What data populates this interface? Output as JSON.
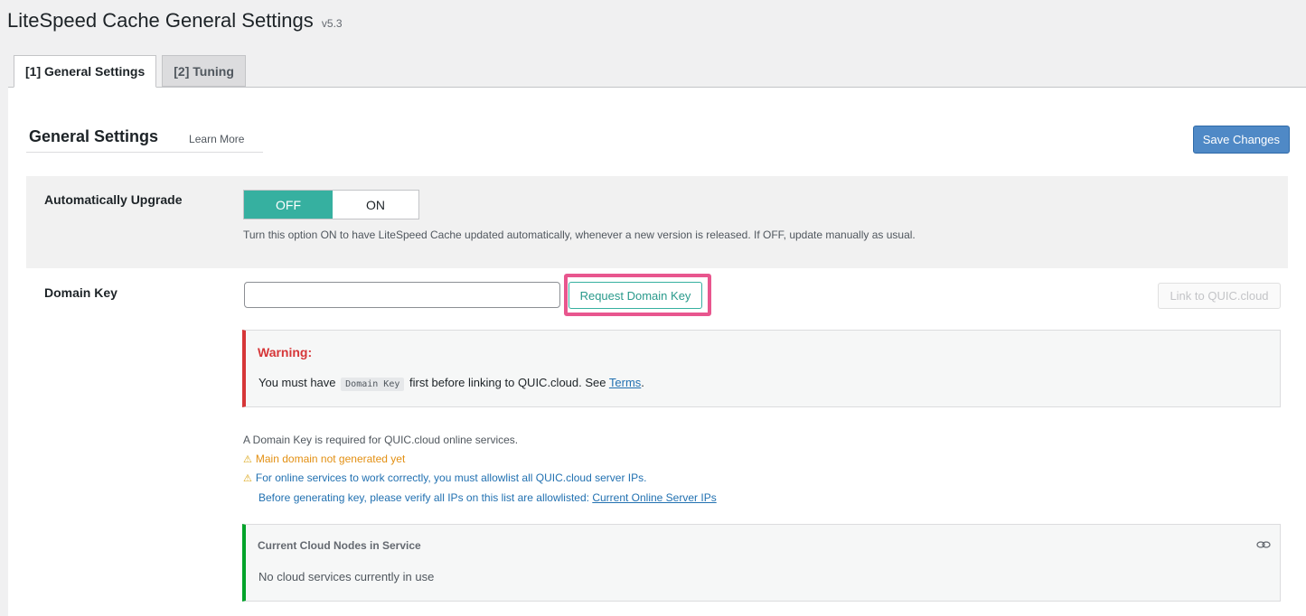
{
  "header": {
    "title": "LiteSpeed Cache General Settings",
    "version": "v5.3"
  },
  "tabs": [
    {
      "label": "[1] General Settings",
      "active": true
    },
    {
      "label": "[2] Tuning",
      "active": false
    }
  ],
  "section": {
    "title": "General Settings",
    "learn_more": "Learn More",
    "save_label": "Save Changes"
  },
  "auto_upgrade": {
    "label": "Automatically Upgrade",
    "off_label": "OFF",
    "on_label": "ON",
    "selected": "OFF",
    "description": "Turn this option ON to have LiteSpeed Cache updated automatically, whenever a new version is released. If OFF, update manually as usual."
  },
  "domain_key": {
    "label": "Domain Key",
    "input_value": "",
    "request_button": "Request Domain Key",
    "link_button": "Link to QUIC.cloud",
    "warning": {
      "title": "Warning:",
      "text_before": "You must have",
      "code": "Domain Key",
      "text_after": "first before linking to QUIC.cloud. See",
      "link": "Terms",
      "period": "."
    },
    "info": {
      "required": "A Domain Key is required for QUIC.cloud online services.",
      "main_domain": "Main domain not generated yet",
      "allowlist": "For online services to work correctly, you must allowlist all QUIC.cloud server IPs.",
      "verify_text": "Before generating key, please verify all IPs on this list are allowlisted:",
      "verify_link": "Current Online Server IPs"
    },
    "nodes": {
      "title": "Current Cloud Nodes in Service",
      "text": "No cloud services currently in use",
      "icon": "link-icon"
    }
  },
  "colors": {
    "accent_teal": "#36b0a0",
    "primary_blue": "#4f89c6",
    "warning_red": "#d63638",
    "success_green": "#00a32a",
    "highlight_pink": "#e8568e",
    "notice_orange": "#e39013"
  }
}
